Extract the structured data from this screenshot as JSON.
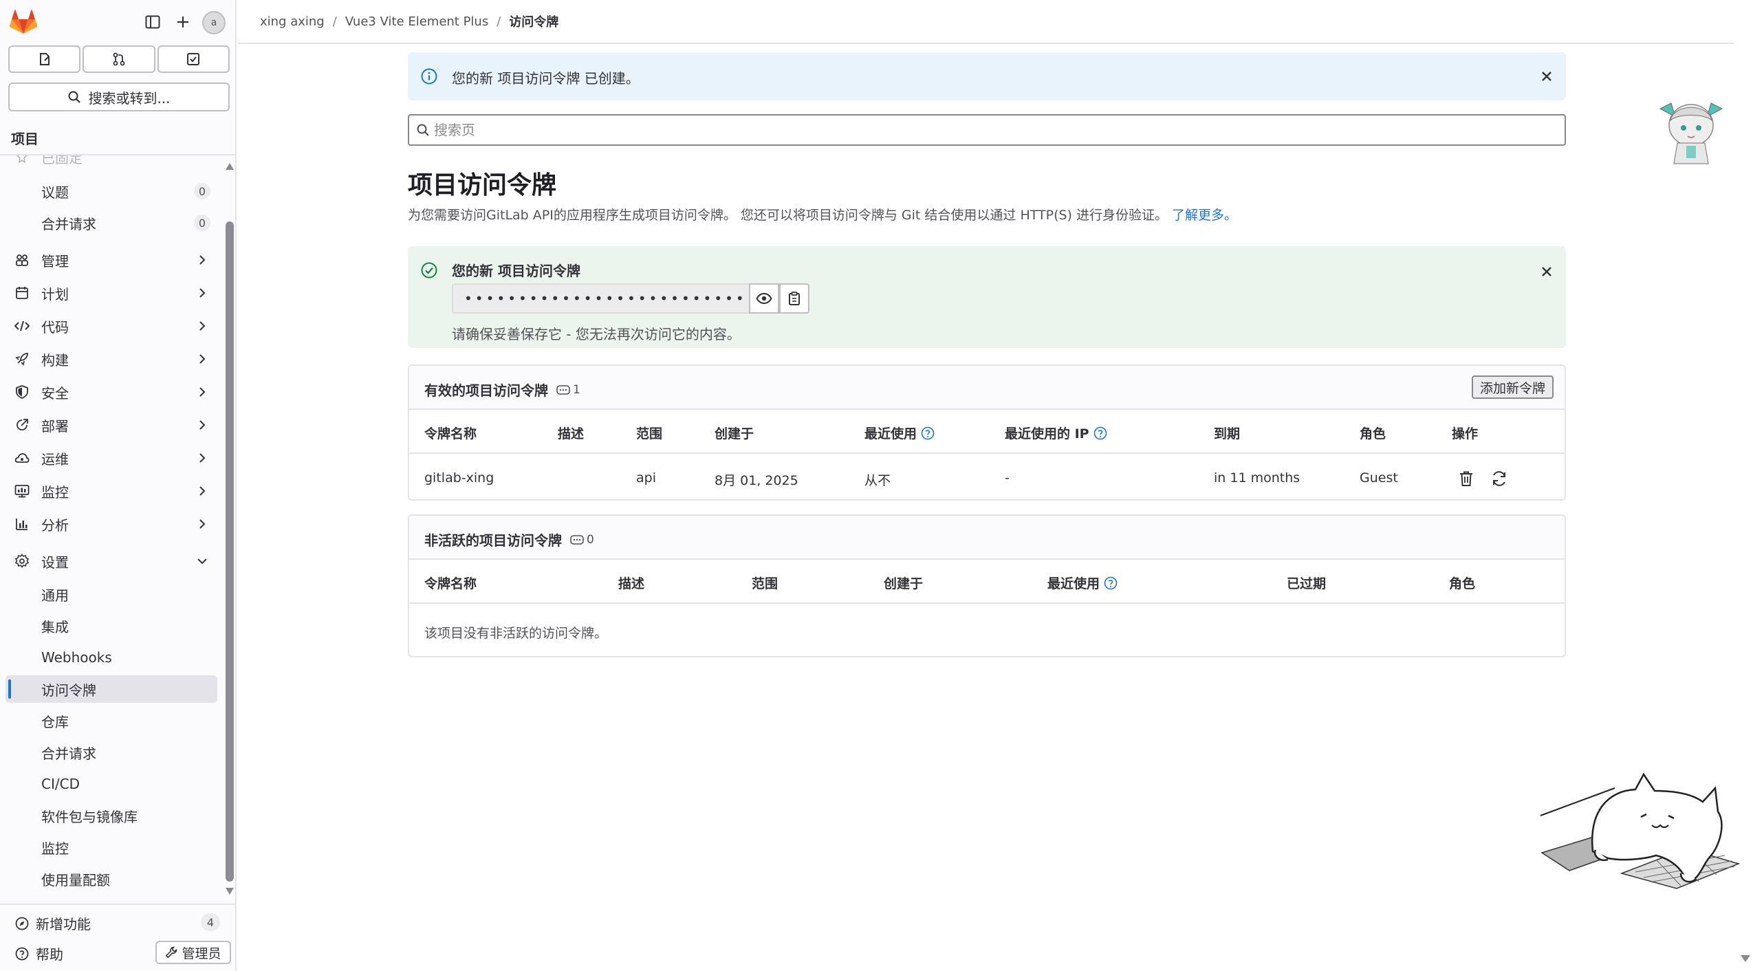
{
  "sidebar": {
    "quick": [
      "issues-shortcut",
      "merge-requests-shortcut",
      "todos-shortcut"
    ],
    "search_label": "搜索或转到...",
    "section_title": "项目",
    "cut_off_label": "已固定",
    "pinned": [
      {
        "label": "议题",
        "count": "0"
      },
      {
        "label": "合并请求",
        "count": "0"
      }
    ],
    "groups": [
      {
        "label": "管理",
        "icon": "users-icon"
      },
      {
        "label": "计划",
        "icon": "calendar-icon"
      },
      {
        "label": "代码",
        "icon": "code-icon"
      },
      {
        "label": "构建",
        "icon": "rocket-icon"
      },
      {
        "label": "安全",
        "icon": "shield-icon"
      },
      {
        "label": "部署",
        "icon": "deploy-icon"
      },
      {
        "label": "运维",
        "icon": "cloud-icon"
      },
      {
        "label": "监控",
        "icon": "monitor-icon"
      },
      {
        "label": "分析",
        "icon": "chart-icon"
      },
      {
        "label": "设置",
        "icon": "gear-icon"
      }
    ],
    "settings_items": [
      "通用",
      "集成",
      "Webhooks",
      "访问令牌",
      "仓库",
      "合并请求",
      "CI/CD",
      "软件包与镜像库",
      "监控",
      "使用量配额"
    ],
    "active_item": "访问令牌",
    "whats_new": {
      "label": "新增功能",
      "count": "4"
    },
    "help": "帮助",
    "admin": "管理员",
    "avatar_text": "a"
  },
  "breadcrumb": {
    "items": [
      "xing axing",
      "Vue3 Vite Element Plus",
      "访问令牌"
    ]
  },
  "info_alert": "您的新 项目访问令牌 已创建。",
  "search": {
    "placeholder": "搜索页"
  },
  "page": {
    "title": "项目访问令牌",
    "description": "为您需要访问GitLab API的应用程序生成项目访问令牌。 您还可以将项目访问令牌与 Git 结合使用以通过 HTTP(S) 进行身份验证。",
    "learn_more": "了解更多。"
  },
  "new_token": {
    "title": "您的新 项目访问令牌",
    "masked_value": "••••••••••••••••••••••••••",
    "hint": "请确保妥善保存它 - 您无法再次访问它的内容。"
  },
  "active_tokens": {
    "title": "有效的项目访问令牌",
    "count": "1",
    "add_button": "添加新令牌",
    "headers": [
      "令牌名称",
      "描述",
      "范围",
      "创建于",
      "最近使用",
      "最近使用的 IP",
      "到期",
      "角色",
      "操作"
    ],
    "rows": [
      {
        "name": "gitlab-xing",
        "description": "",
        "scope": "api",
        "created": "8月 01, 2025",
        "last_used": "从不",
        "last_ip": "-",
        "expires": "in 11 months",
        "role": "Guest"
      }
    ]
  },
  "inactive_tokens": {
    "title": "非活跃的项目访问令牌",
    "count": "0",
    "headers": [
      "令牌名称",
      "描述",
      "范围",
      "创建于",
      "最近使用",
      "已过期",
      "角色"
    ],
    "empty": "该项目没有非活跃的访问令牌。"
  },
  "colors": {
    "accent": "#1f75cb",
    "info_bg": "#e9f3fc",
    "success_bg": "#ecf4ee",
    "success_icon": "#108548",
    "gitlab_orange": "#fc6d26"
  }
}
